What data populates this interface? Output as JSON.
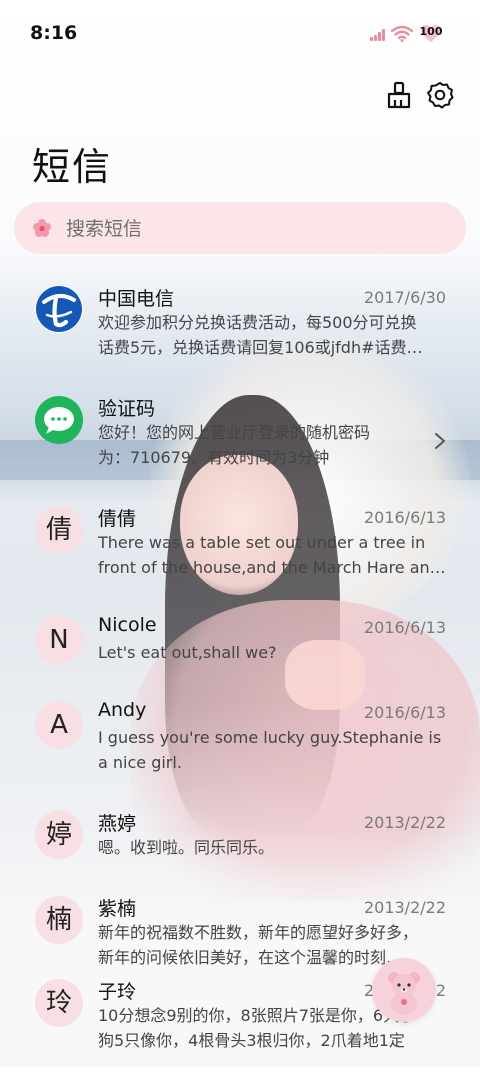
{
  "status_bar": {
    "time": "8:16",
    "battery": "100",
    "accent": "#f08a9a"
  },
  "header": {
    "title": "短信",
    "clean_icon": "broom-icon",
    "settings_icon": "gear-icon"
  },
  "search": {
    "placeholder": "搜索短信",
    "icon": "flower-search-icon",
    "background": "#fbe5e8"
  },
  "messages": [
    {
      "name": "中国电信",
      "date": "2017/6/30",
      "avatar": "china-telecom-logo",
      "preview": [
        "欢迎参加积分兑换话费活动，每500分可兑换",
        "话费5元，兑换话费请回复106或jfdh#话费…"
      ]
    },
    {
      "name": "验证码",
      "date": "",
      "avatar": "message-icon",
      "preview": [
        "您好！您的网上营业厅登录的随机密码",
        "为：710679。有效时间为3分钟"
      ]
    },
    {
      "name": "倩倩",
      "date": "2016/6/13",
      "avatar": "倩",
      "preview": [
        "There was a table set out under a tree in",
        "front of the house,and the March Hare an…"
      ]
    },
    {
      "name": "Nicole",
      "date": "2016/6/13",
      "avatar": "N",
      "preview": [
        "Let's eat out,shall we?"
      ]
    },
    {
      "name": "Andy",
      "date": "2016/6/13",
      "avatar": "A",
      "preview": [
        "I guess you're some lucky guy.Stephanie is",
        "a nice girl."
      ]
    },
    {
      "name": "燕婷",
      "date": "2013/2/22",
      "avatar": "婷",
      "preview": [
        "嗯。收到啦。同乐同乐。"
      ]
    },
    {
      "name": "紫楠",
      "date": "2013/2/22",
      "avatar": "楠",
      "preview": [
        "新年的祝福数不胜数，新年的愿望好多好多，",
        "新年的问候依旧美好，在这个温馨的时刻…"
      ]
    },
    {
      "name": "子玲",
      "date": "2013/2/22",
      "avatar": "玲",
      "preview": [
        "10分想念9别的你，8张照片7张是你，6只小",
        "狗5只像你，4根骨头3根归你，2爪着地1定"
      ]
    }
  ],
  "fab": {
    "icon": "teddy-bear-compose-icon"
  }
}
